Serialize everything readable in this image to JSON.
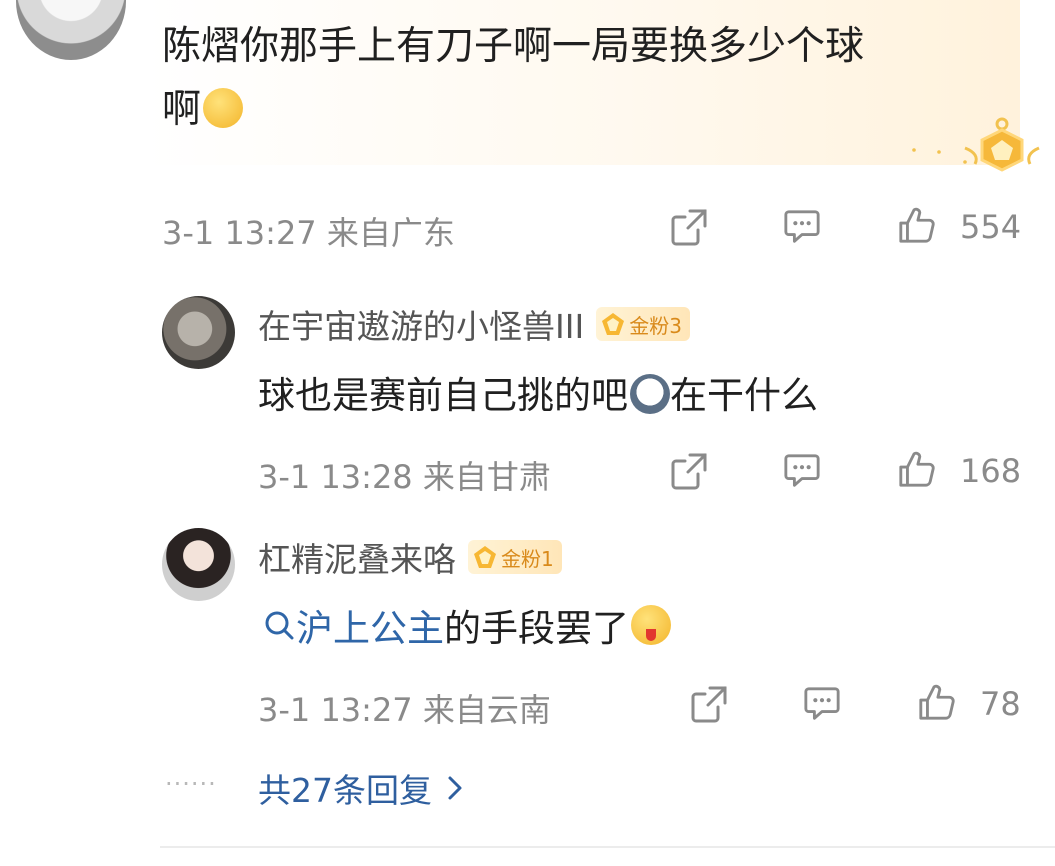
{
  "top_comment": {
    "text_line1": "陈熠你那手上有刀子啊一局要换多少个球",
    "text_line2": "啊",
    "emoji": "smirk-emoji",
    "meta": "3-1 13:27 来自广东",
    "likes": "554"
  },
  "replies": [
    {
      "username": "在宇宙遨游的小怪兽III",
      "badge": "金粉3",
      "text_a": "球也是赛前自己挑的吧",
      "emoji": "husky-emoji",
      "text_b": "在干什么",
      "meta": "3-1 13:28 来自甘肃",
      "likes": "168"
    },
    {
      "username": "杠精泥叠来咯",
      "badge": "金粉1",
      "link_text": "沪上公主",
      "text": " 的手段罢了",
      "emoji": "tongue-out-emoji",
      "meta": "3-1 13:27 来自云南",
      "likes": "78"
    }
  ],
  "more_replies": {
    "dots": "······",
    "label": "共27条回复"
  },
  "colors": {
    "link": "#2f66a8",
    "badge_text": "#d98a1b",
    "meta_gray": "#8a8a8a"
  }
}
